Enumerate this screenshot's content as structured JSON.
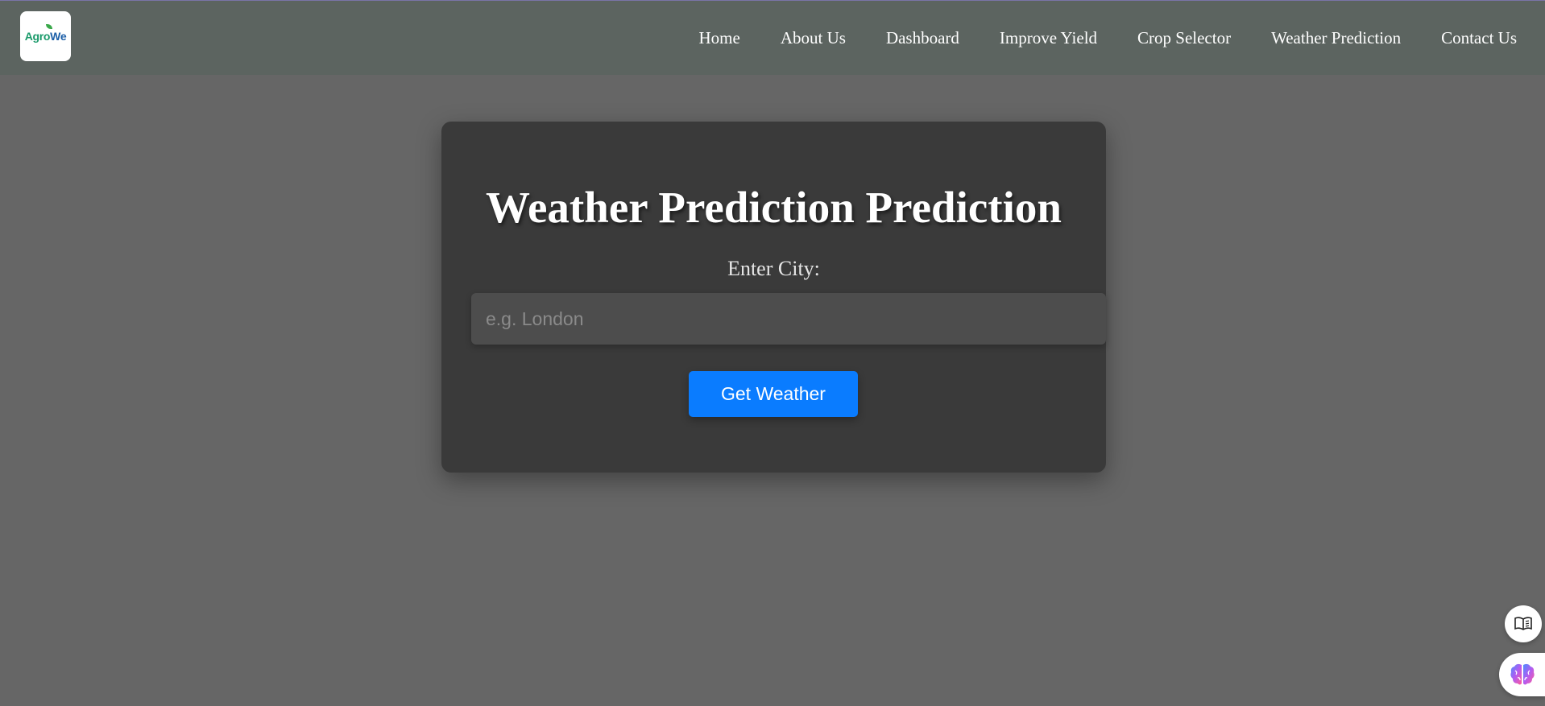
{
  "brand": {
    "logo_text_part1": "Agro",
    "logo_text_part2": "We"
  },
  "nav": {
    "items": [
      {
        "label": "Home"
      },
      {
        "label": "About Us"
      },
      {
        "label": "Dashboard"
      },
      {
        "label": "Improve Yield"
      },
      {
        "label": "Crop Selector"
      },
      {
        "label": "Weather Prediction"
      },
      {
        "label": "Contact Us"
      }
    ]
  },
  "form": {
    "title": "Weather Prediction Prediction",
    "city_label": "Enter City:",
    "city_placeholder": "e.g. London",
    "city_value": "",
    "submit_label": "Get Weather"
  },
  "floating": {
    "reader_icon": "book-reader-icon",
    "assistant_icon": "brain-icon"
  },
  "colors": {
    "background": "#666666",
    "navbar": "#5c6460",
    "card": "#3a3a3a",
    "input": "#4d4d4d",
    "button": "#0a7cff"
  }
}
